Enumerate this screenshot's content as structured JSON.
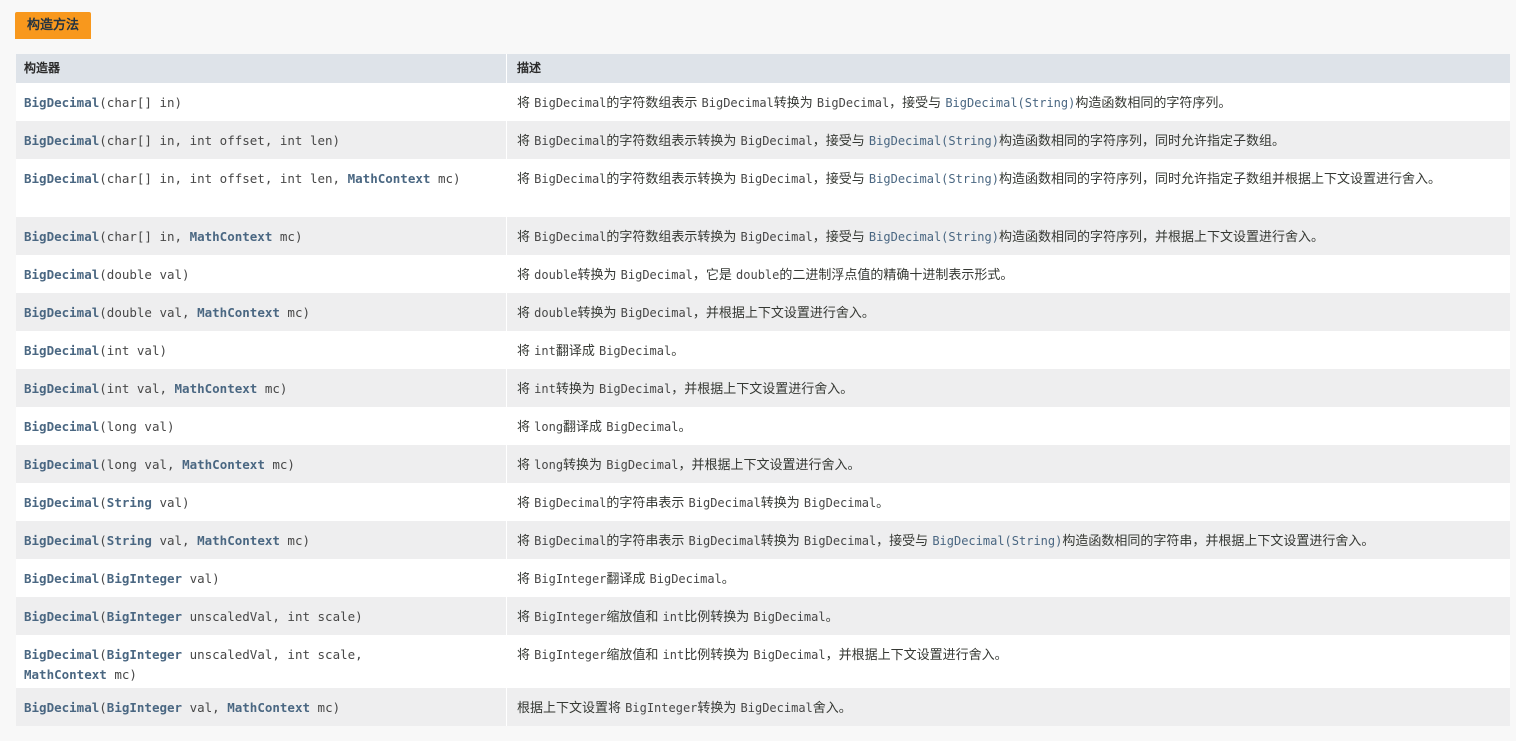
{
  "caption": "构造方法",
  "headers": {
    "col1": "构造器",
    "col2": "描述"
  },
  "rows": [
    {
      "sig": [
        [
          "BigDecimal",
          "l"
        ],
        [
          "(char[] in)",
          "t"
        ]
      ],
      "desc": [
        [
          "将 ",
          "p"
        ],
        [
          "BigDecimal",
          "m"
        ],
        [
          "的字符数组表示 ",
          "p"
        ],
        [
          "BigDecimal",
          "m"
        ],
        [
          "转换为 ",
          "p"
        ],
        [
          "BigDecimal",
          "m"
        ],
        [
          "，接受与 ",
          "p"
        ],
        [
          "BigDecimal(String)",
          "ml"
        ],
        [
          "构造函数相同的字符序列。",
          "p"
        ]
      ]
    },
    {
      "sig": [
        [
          "BigDecimal",
          "l"
        ],
        [
          "(char[] in, int offset, int len)",
          "t"
        ]
      ],
      "desc": [
        [
          "将 ",
          "p"
        ],
        [
          "BigDecimal",
          "m"
        ],
        [
          "的字符数组表示转换为 ",
          "p"
        ],
        [
          "BigDecimal",
          "m"
        ],
        [
          "，接受与 ",
          "p"
        ],
        [
          "BigDecimal(String)",
          "ml"
        ],
        [
          "构造函数相同的字符序列，同时允许指定子数组。",
          "p"
        ]
      ]
    },
    {
      "sig": [
        [
          "BigDecimal",
          "l"
        ],
        [
          "(char[] in, int offset, int len, ",
          "t"
        ],
        [
          "MathContext",
          "l"
        ],
        [
          " mc)",
          "t"
        ]
      ],
      "desc": [
        [
          "将 ",
          "p"
        ],
        [
          "BigDecimal",
          "m"
        ],
        [
          "的字符数组表示转换为 ",
          "p"
        ],
        [
          "BigDecimal",
          "m"
        ],
        [
          "，接受与 ",
          "p"
        ],
        [
          "BigDecimal(String)",
          "ml"
        ],
        [
          "构造函数相同的字符序列，同时允许指定子数组并根据上下文设置进行舍入。",
          "p"
        ]
      ],
      "tall": true
    },
    {
      "sig": [
        [
          "BigDecimal",
          "l"
        ],
        [
          "(char[] in, ",
          "t"
        ],
        [
          "MathContext",
          "l"
        ],
        [
          " mc)",
          "t"
        ]
      ],
      "desc": [
        [
          "将 ",
          "p"
        ],
        [
          "BigDecimal",
          "m"
        ],
        [
          "的字符数组表示转换为 ",
          "p"
        ],
        [
          "BigDecimal",
          "m"
        ],
        [
          "，接受与 ",
          "p"
        ],
        [
          "BigDecimal(String)",
          "ml"
        ],
        [
          "构造函数相同的字符序列，并根据上下文设置进行舍入。",
          "p"
        ]
      ]
    },
    {
      "sig": [
        [
          "BigDecimal",
          "l"
        ],
        [
          "(double val)",
          "t"
        ]
      ],
      "desc": [
        [
          "将 ",
          "p"
        ],
        [
          "double",
          "m"
        ],
        [
          "转换为 ",
          "p"
        ],
        [
          "BigDecimal",
          "m"
        ],
        [
          "，它是 ",
          "p"
        ],
        [
          "double",
          "m"
        ],
        [
          "的二进制浮点值的精确十进制表示形式。",
          "p"
        ]
      ]
    },
    {
      "sig": [
        [
          "BigDecimal",
          "l"
        ],
        [
          "(double val, ",
          "t"
        ],
        [
          "MathContext",
          "l"
        ],
        [
          " mc)",
          "t"
        ]
      ],
      "desc": [
        [
          "将 ",
          "p"
        ],
        [
          "double",
          "m"
        ],
        [
          "转换为 ",
          "p"
        ],
        [
          "BigDecimal",
          "m"
        ],
        [
          "，并根据上下文设置进行舍入。",
          "p"
        ]
      ]
    },
    {
      "sig": [
        [
          "BigDecimal",
          "l"
        ],
        [
          "(int val)",
          "t"
        ]
      ],
      "desc": [
        [
          "将 ",
          "p"
        ],
        [
          "int",
          "m"
        ],
        [
          "翻译成 ",
          "p"
        ],
        [
          "BigDecimal",
          "m"
        ],
        [
          "。",
          "p"
        ]
      ]
    },
    {
      "sig": [
        [
          "BigDecimal",
          "l"
        ],
        [
          "(int val, ",
          "t"
        ],
        [
          "MathContext",
          "l"
        ],
        [
          " mc)",
          "t"
        ]
      ],
      "desc": [
        [
          "将 ",
          "p"
        ],
        [
          "int",
          "m"
        ],
        [
          "转换为 ",
          "p"
        ],
        [
          "BigDecimal",
          "m"
        ],
        [
          "，并根据上下文设置进行舍入。",
          "p"
        ]
      ]
    },
    {
      "sig": [
        [
          "BigDecimal",
          "l"
        ],
        [
          "(long val)",
          "t"
        ]
      ],
      "desc": [
        [
          "将 ",
          "p"
        ],
        [
          "long",
          "m"
        ],
        [
          "翻译成 ",
          "p"
        ],
        [
          "BigDecimal",
          "m"
        ],
        [
          "。",
          "p"
        ]
      ]
    },
    {
      "sig": [
        [
          "BigDecimal",
          "l"
        ],
        [
          "(long val, ",
          "t"
        ],
        [
          "MathContext",
          "l"
        ],
        [
          " mc)",
          "t"
        ]
      ],
      "desc": [
        [
          "将 ",
          "p"
        ],
        [
          "long",
          "m"
        ],
        [
          "转换为 ",
          "p"
        ],
        [
          "BigDecimal",
          "m"
        ],
        [
          "，并根据上下文设置进行舍入。",
          "p"
        ]
      ]
    },
    {
      "sig": [
        [
          "BigDecimal",
          "l"
        ],
        [
          "(",
          "t"
        ],
        [
          "String",
          "l"
        ],
        [
          " val)",
          "t"
        ]
      ],
      "desc": [
        [
          "将 ",
          "p"
        ],
        [
          "BigDecimal",
          "m"
        ],
        [
          "的字符串表示 ",
          "p"
        ],
        [
          "BigDecimal",
          "m"
        ],
        [
          "转换为 ",
          "p"
        ],
        [
          "BigDecimal",
          "m"
        ],
        [
          "。",
          "p"
        ]
      ]
    },
    {
      "sig": [
        [
          "BigDecimal",
          "l"
        ],
        [
          "(",
          "t"
        ],
        [
          "String",
          "l"
        ],
        [
          " val, ",
          "t"
        ],
        [
          "MathContext",
          "l"
        ],
        [
          " mc)",
          "t"
        ]
      ],
      "desc": [
        [
          "将 ",
          "p"
        ],
        [
          "BigDecimal",
          "m"
        ],
        [
          "的字符串表示 ",
          "p"
        ],
        [
          "BigDecimal",
          "m"
        ],
        [
          "转换为 ",
          "p"
        ],
        [
          "BigDecimal",
          "m"
        ],
        [
          "，接受与 ",
          "p"
        ],
        [
          "BigDecimal(String)",
          "ml"
        ],
        [
          "构造函数相同的字符串，并根据上下文设置进行舍入。",
          "p"
        ]
      ]
    },
    {
      "sig": [
        [
          "BigDecimal",
          "l"
        ],
        [
          "(",
          "t"
        ],
        [
          "BigInteger",
          "l"
        ],
        [
          " val)",
          "t"
        ]
      ],
      "desc": [
        [
          "将 ",
          "p"
        ],
        [
          "BigInteger",
          "m"
        ],
        [
          "翻译成 ",
          "p"
        ],
        [
          "BigDecimal",
          "m"
        ],
        [
          "。",
          "p"
        ]
      ]
    },
    {
      "sig": [
        [
          "BigDecimal",
          "l"
        ],
        [
          "(",
          "t"
        ],
        [
          "BigInteger",
          "l"
        ],
        [
          " unscaledVal, int scale)",
          "t"
        ]
      ],
      "desc": [
        [
          "将 ",
          "p"
        ],
        [
          "BigInteger",
          "m"
        ],
        [
          "缩放值和 ",
          "p"
        ],
        [
          "int",
          "m"
        ],
        [
          "比例转换为 ",
          "p"
        ],
        [
          "BigDecimal",
          "m"
        ],
        [
          "。",
          "p"
        ]
      ]
    },
    {
      "sig": [
        [
          "BigDecimal",
          "l"
        ],
        [
          "(",
          "t"
        ],
        [
          "BigInteger",
          "l"
        ],
        [
          " unscaledVal, int scale,",
          "t"
        ],
        [
          "\n",
          "br"
        ],
        [
          "MathContext",
          "l"
        ],
        [
          " mc)",
          "t"
        ]
      ],
      "desc": [
        [
          "将 ",
          "p"
        ],
        [
          "BigInteger",
          "m"
        ],
        [
          "缩放值和 ",
          "p"
        ],
        [
          "int",
          "m"
        ],
        [
          "比例转换为 ",
          "p"
        ],
        [
          "BigDecimal",
          "m"
        ],
        [
          "，并根据上下文设置进行舍入。",
          "p"
        ]
      ],
      "tall": true
    },
    {
      "sig": [
        [
          "BigDecimal",
          "l"
        ],
        [
          "(",
          "t"
        ],
        [
          "BigInteger",
          "l"
        ],
        [
          " val, ",
          "t"
        ],
        [
          "MathContext",
          "l"
        ],
        [
          " mc)",
          "t"
        ]
      ],
      "desc": [
        [
          "根据上下文设置将 ",
          "p"
        ],
        [
          "BigInteger",
          "m"
        ],
        [
          "转换为 ",
          "p"
        ],
        [
          "BigDecimal",
          "m"
        ],
        [
          "舍入。",
          "p"
        ]
      ]
    }
  ]
}
